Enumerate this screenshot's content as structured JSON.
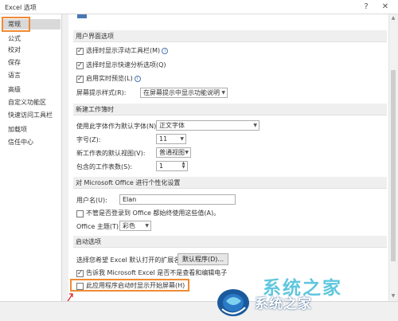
{
  "window": {
    "title": "Excel 选项",
    "help_icon": "?",
    "close_icon": "✕",
    "accent_color": "#f08a34"
  },
  "sidebar": {
    "items": [
      {
        "label": "常规",
        "selected": true
      },
      {
        "label": "公式"
      },
      {
        "label": "校对"
      },
      {
        "label": "保存"
      },
      {
        "label": "语言"
      },
      {
        "label": "高级"
      },
      {
        "label": "自定义功能区"
      },
      {
        "label": "快速访问工具栏"
      },
      {
        "label": "加载项"
      },
      {
        "label": "信任中心"
      }
    ]
  },
  "ui_section": {
    "header": "用户界面选项",
    "options": [
      {
        "label": "选择时显示浮动工具栏(M)",
        "checked": true
      },
      {
        "label": "选择时显示快速分析选项(Q)",
        "checked": true
      },
      {
        "label": "启用实时预览(L)",
        "checked": true
      }
    ],
    "tooltip_label": "屏幕提示样式(R):",
    "tooltip_value": "在屏幕提示中显示功能说明",
    "info_icon": "i"
  },
  "new_workbook": {
    "header": "新建工作簿时",
    "font_label": "使用此字体作为默认字体(N):",
    "font_value": "正文字体",
    "size_label": "字号(Z):",
    "size_value": "11",
    "view_label": "新工作表的默认视图(V):",
    "view_value": "普通视图",
    "sheets_label": "包含的工作表数(S):",
    "sheets_value": "1"
  },
  "personalize": {
    "header": "对 Microsoft Office 进行个性化设置",
    "username_label": "用户名(U):",
    "username_value": "Elan",
    "always_use_label": "不管是否登录到 Office 都始终使用这些值(A)。",
    "always_use_checked": false,
    "theme_label": "Office 主题(T):",
    "theme_value": "彩色"
  },
  "startup": {
    "header": "启动选项",
    "extensions_label": "选择您希望 Excel 默认打开的扩展名:",
    "default_programs_button": "默认程序(D)...",
    "notify_label": "告诉我 Microsoft Excel 是否不是查看和编辑电子",
    "notify_checked": true,
    "start_screen_label": "此应用程序启动时显示开始屏幕(H)",
    "start_screen_checked": false
  },
  "watermark": {
    "top_text": "系统之家",
    "bottom_text": "系统之家"
  }
}
